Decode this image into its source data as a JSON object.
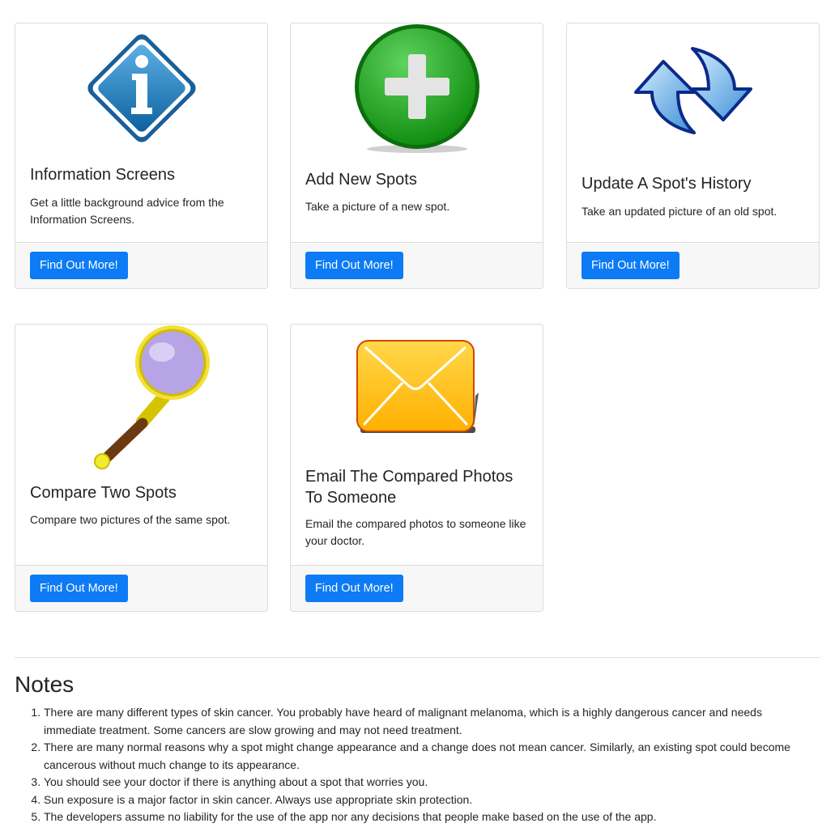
{
  "cards": [
    {
      "title": "Information Screens",
      "text": "Get a little background advice from the Information Screens.",
      "button": "Find Out More!",
      "icon": "info-diamond-icon"
    },
    {
      "title": "Add New Spots",
      "text": "Take a picture of a new spot.",
      "button": "Find Out More!",
      "icon": "plus-circle-icon"
    },
    {
      "title": "Update A Spot's History",
      "text": "Take an updated picture of an old spot.",
      "button": "Find Out More!",
      "icon": "refresh-arrows-icon"
    },
    {
      "title": "Compare Two Spots",
      "text": "Compare two pictures of the same spot.",
      "button": "Find Out More!",
      "icon": "magnifying-glass-icon"
    },
    {
      "title": "Email The Compared Photos To Someone",
      "text": "Email the compared photos to someone like your doctor.",
      "button": "Find Out More!",
      "icon": "envelope-icon"
    }
  ],
  "notes": {
    "title": "Notes",
    "items": [
      "There are many different types of skin cancer. You probably have heard of malignant melanoma, which is a highly dangerous cancer and needs immediate treatment. Some cancers are slow growing and may not need treatment.",
      "There are many normal reasons why a spot might change appearance and a change does not mean cancer. Similarly, an existing spot could become cancerous without much change to its appearance.",
      "You should see your doctor if there is anything about a spot that worries you.",
      "Sun exposure is a major factor in skin cancer. Always use appropriate skin protection.",
      "The developers assume no liability for the use of the app nor any decisions that people make based on the use of the app."
    ]
  },
  "colors": {
    "button": "#0d7bf5",
    "footer": "#f7f7f7",
    "border": "#dcdcdc"
  }
}
